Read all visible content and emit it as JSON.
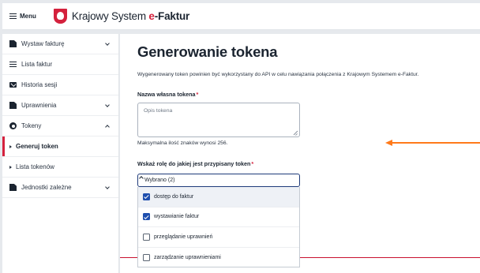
{
  "header": {
    "menu_label": "Menu",
    "brand_prefix": "Krajowy System ",
    "brand_e": "e",
    "brand_suffix": "-Faktur"
  },
  "sidebar": {
    "items": [
      {
        "label": "Wystaw fakturę",
        "icon": "document-icon",
        "chevron": "down"
      },
      {
        "label": "Lista faktur",
        "icon": "list-icon"
      },
      {
        "label": "Historia sesji",
        "icon": "mail-icon"
      },
      {
        "label": "Uprawnienia",
        "icon": "document-icon",
        "chevron": "down"
      },
      {
        "label": "Tokeny",
        "icon": "token-icon",
        "chevron": "up"
      },
      {
        "label": "Generuj token",
        "sub": true,
        "active": true
      },
      {
        "label": "Lista tokenów",
        "sub": true
      },
      {
        "label": "Jednostki zależne",
        "icon": "document-icon",
        "chevron": "down"
      }
    ]
  },
  "main": {
    "title": "Generowanie tokena",
    "intro": "Wygenerowany token powinien być wykorzystany do API w celu nawiązania połączenia z Krajowym Systemem e-Faktur.",
    "token_name_label": "Nazwa własna tokena",
    "token_name_placeholder": "Opis tokena",
    "token_name_hint": "Maksymalna ilość znaków wynosi 256.",
    "role_label": "Wskaż rolę do jakiej jest przypisany token",
    "required_mark": "*",
    "role_select_value": "Wybrano (2)",
    "role_options": [
      {
        "label": "dostęp do faktur",
        "checked": true,
        "highlighted": true
      },
      {
        "label": "wystawianie faktur",
        "checked": true
      },
      {
        "label": "przeglądanie uprawnień",
        "checked": false
      },
      {
        "label": "zarządzanie uprawnieniami",
        "checked": false
      }
    ]
  },
  "colors": {
    "accent_red": "#d4213d",
    "checkbox_blue": "#1f4fae",
    "annotation_arrow": "#ff7a1a"
  }
}
